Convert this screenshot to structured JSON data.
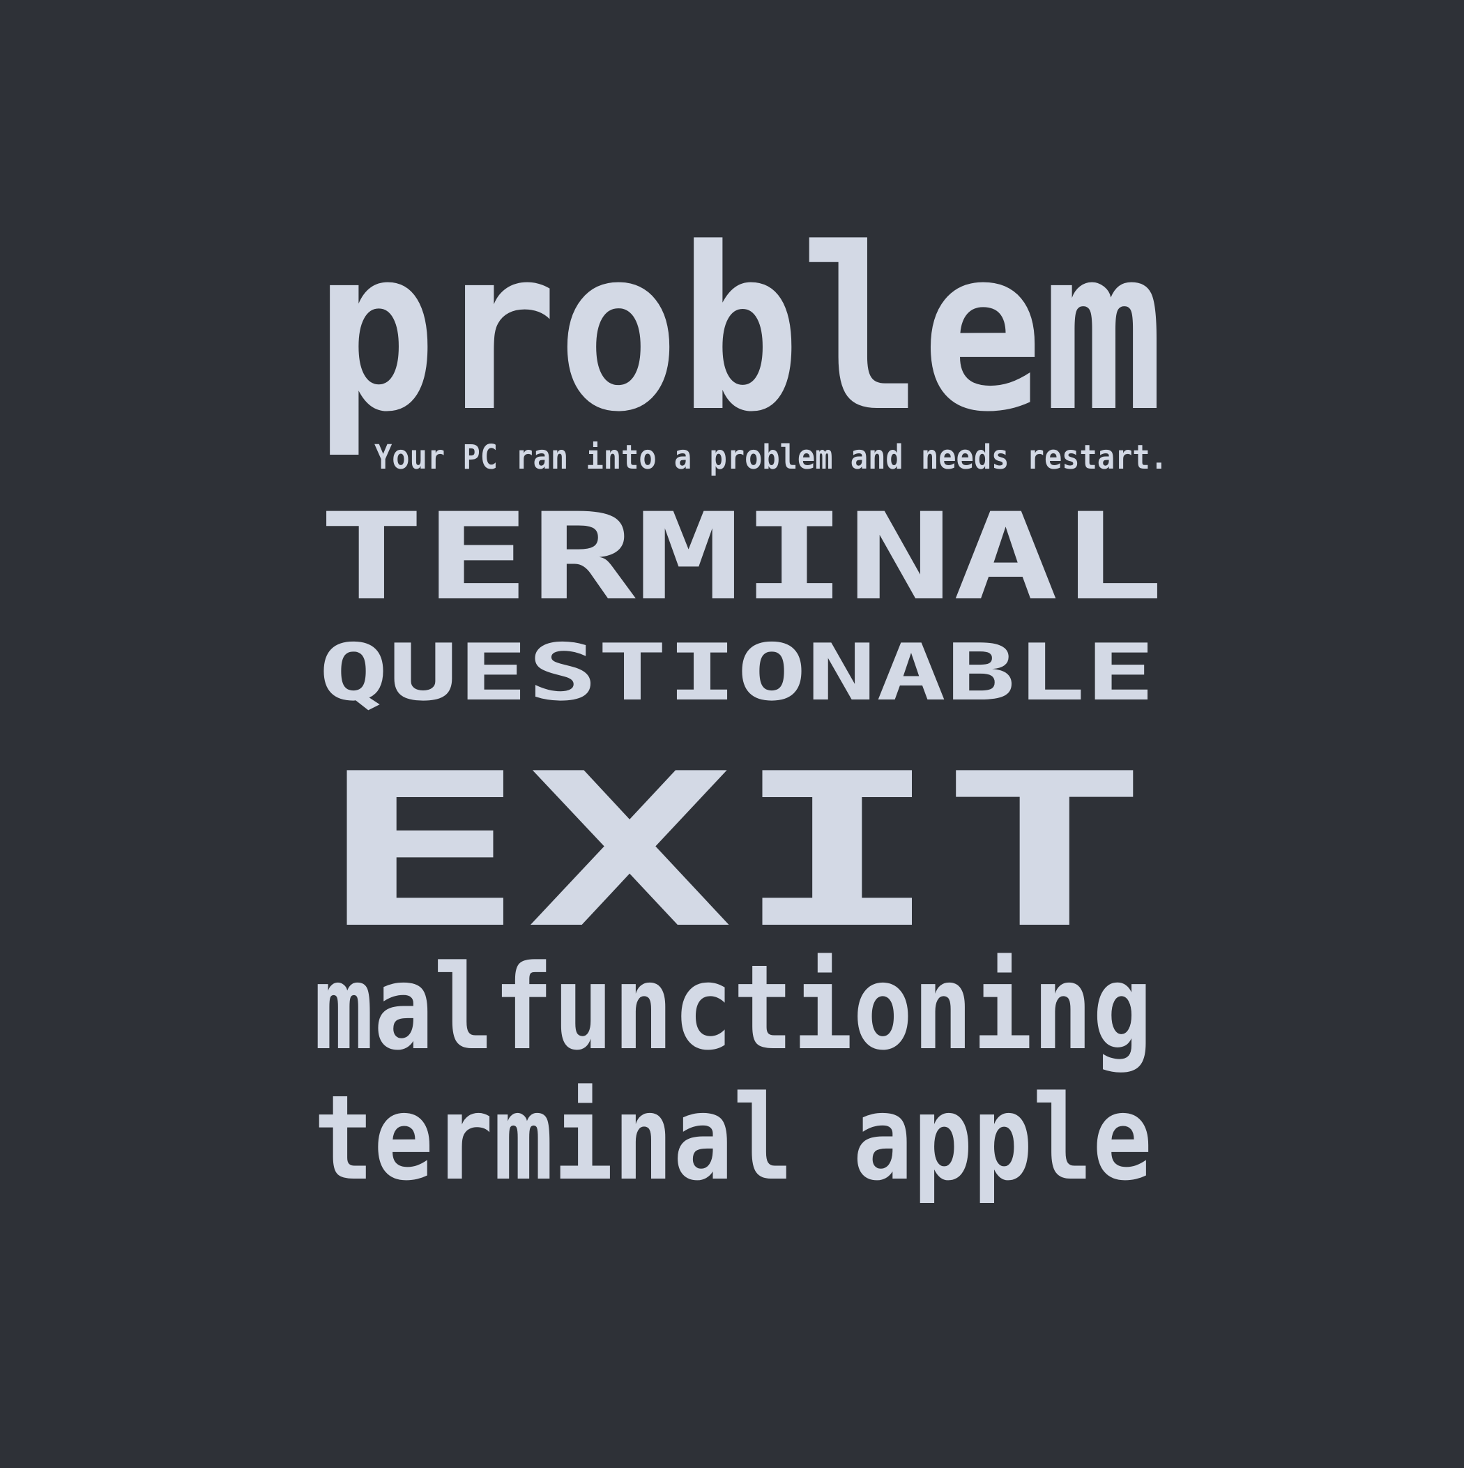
{
  "poster": {
    "words": {
      "line1": "problem",
      "subtitle": "Your PC ran into a problem and needs restart.",
      "line2": "TERMINAL",
      "line3": "QUESTIONABLE",
      "line4": "EXIT",
      "line5": "malfunctioning",
      "line6": "terminal apple"
    },
    "colors": {
      "background": "#2e3137",
      "text": "#d3d9e5"
    }
  }
}
